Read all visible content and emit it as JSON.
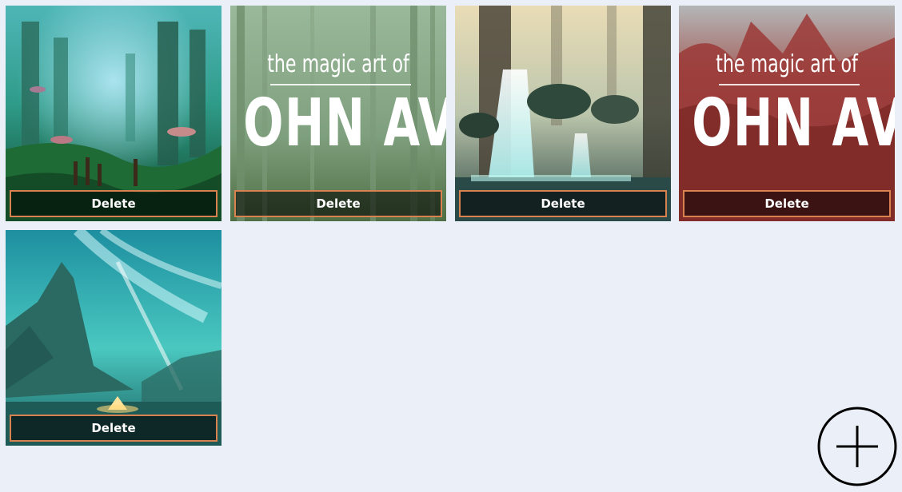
{
  "gallery": {
    "items": [
      {
        "theme": "green-forest",
        "delete_label": "Delete"
      },
      {
        "theme": "green-album",
        "delete_label": "Delete",
        "title_small": "the magic art of",
        "title_big": "OHN AVO"
      },
      {
        "theme": "waterfall",
        "delete_label": "Delete"
      },
      {
        "theme": "red-album",
        "delete_label": "Delete",
        "title_small": "the magic art of",
        "title_big": "OHN AVO"
      },
      {
        "theme": "aurora",
        "delete_label": "Delete"
      }
    ]
  },
  "add_button": {
    "icon": "plus-circle-icon"
  },
  "colors": {
    "background": "#ebeff7",
    "delete_border": "#d98250"
  }
}
